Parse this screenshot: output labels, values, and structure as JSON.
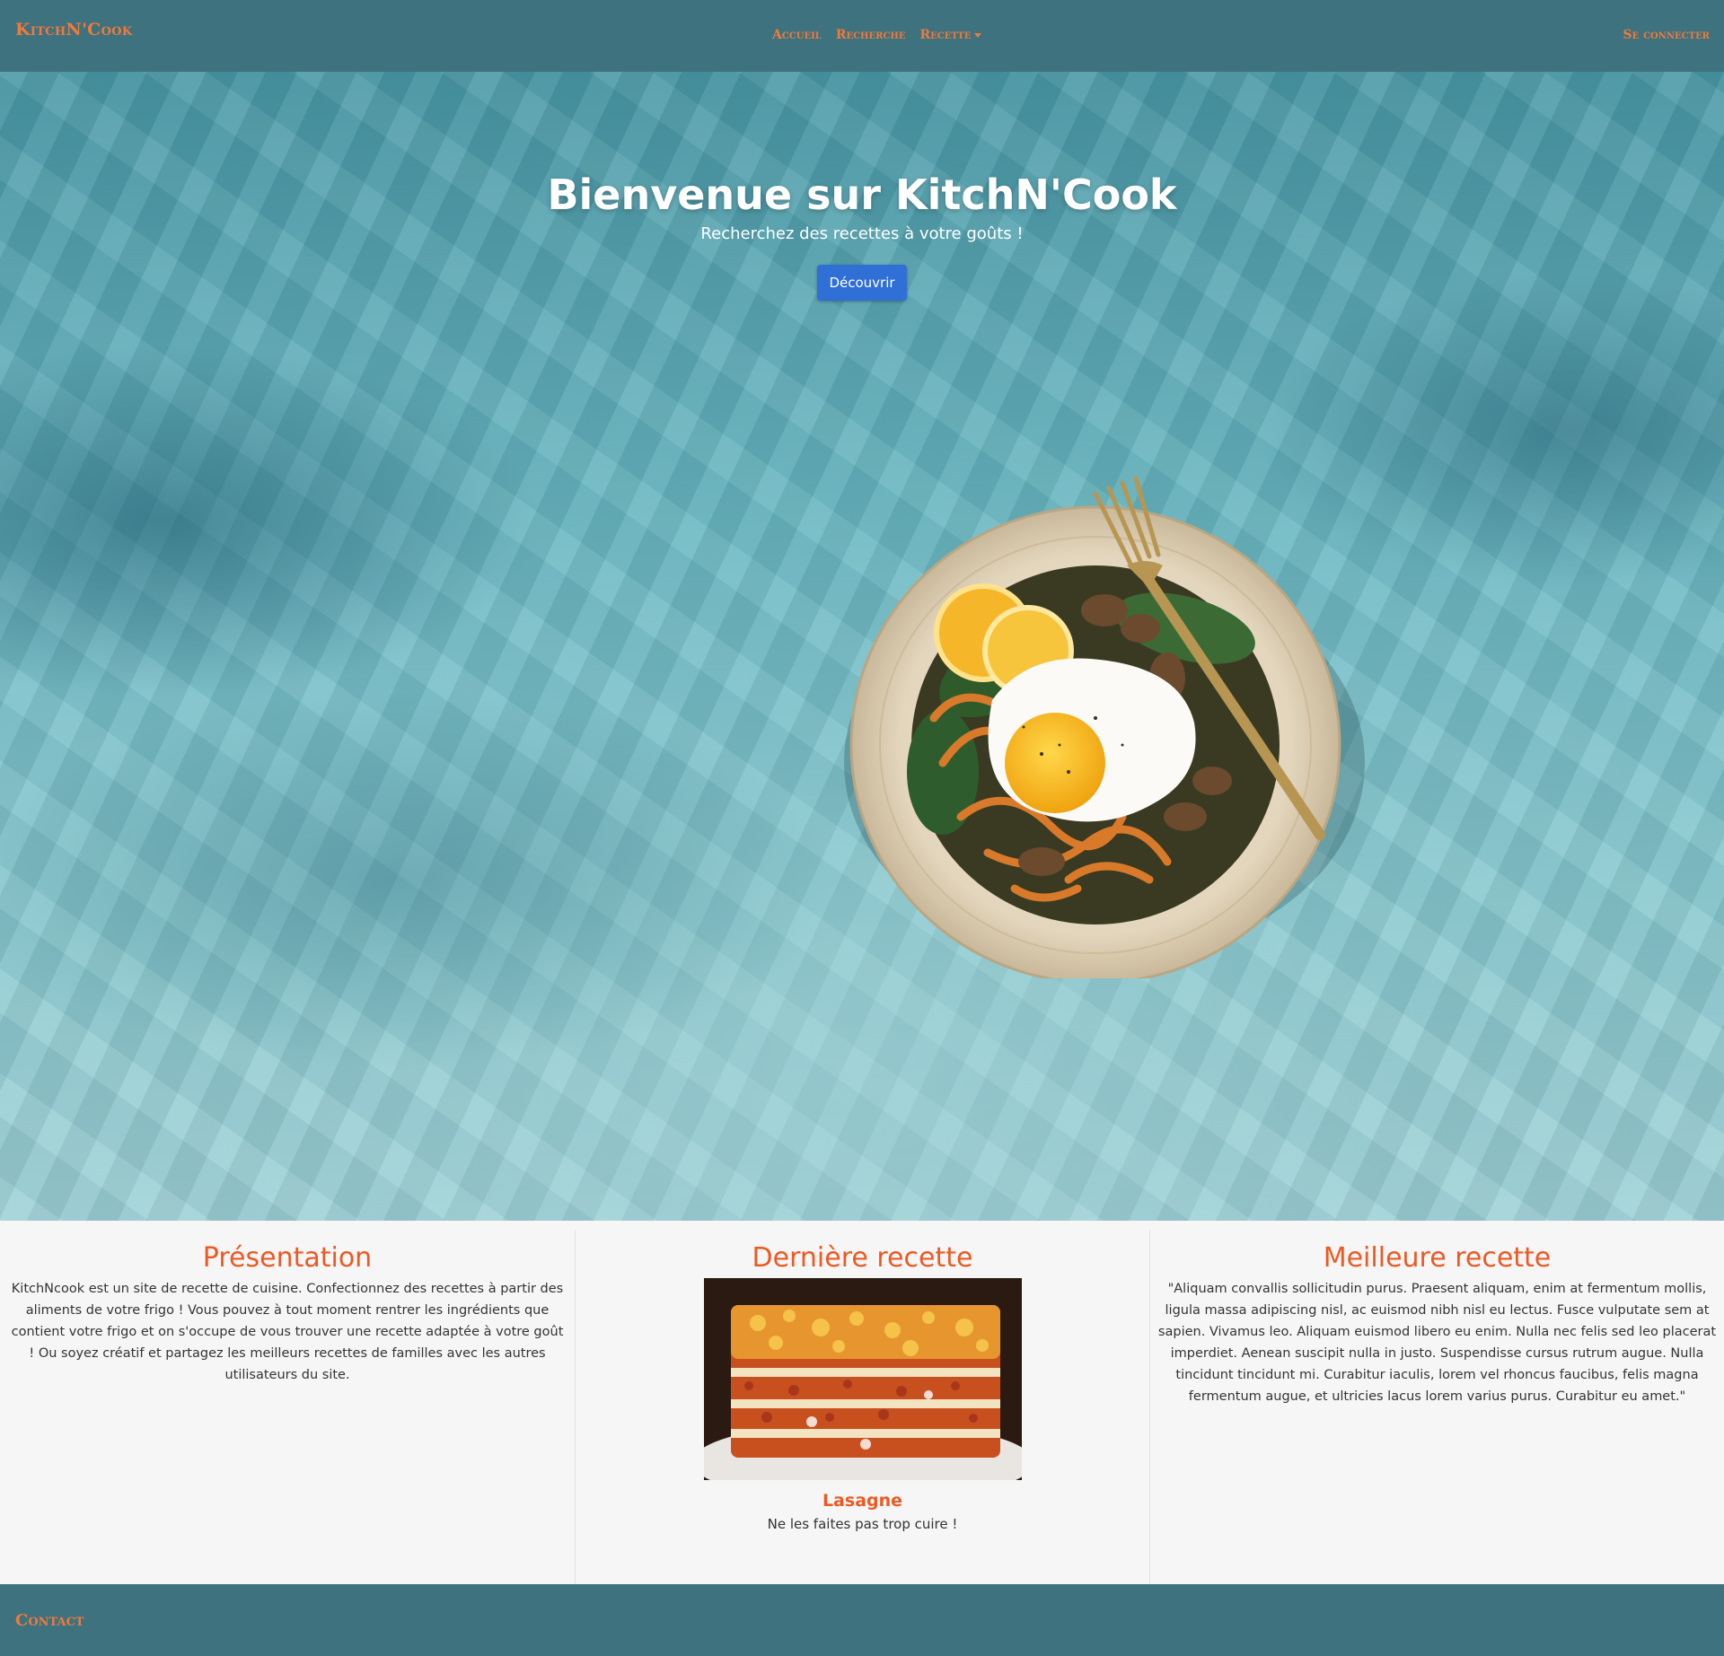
{
  "navbar": {
    "brand": "KitchN'Cook",
    "links": [
      {
        "label": "Accueil"
      },
      {
        "label": "Recherche"
      },
      {
        "label": "Recette"
      }
    ],
    "login_label": "Se connecter"
  },
  "hero": {
    "title": "Bienvenue sur KitchN'Cook",
    "subtitle": "Recherchez des recettes à votre goûts !",
    "button_label": "Découvrir"
  },
  "sections": {
    "presentation": {
      "title": "Présentation",
      "text": "KitchNcook est un site de recette de cuisine. Confectionnez des recettes à partir des aliments de votre frigo ! Vous pouvez à tout moment rentrer les ingrédients que contient votre frigo et on s'occupe de vous trouver une recette adaptée à votre goût ! Ou soyez créatif et partagez les meilleurs recettes de familles avec les autres utilisateurs du site."
    },
    "latest": {
      "title": "Dernière recette",
      "recipe_name": "Lasagne",
      "recipe_desc": "Ne les faites pas trop cuire !"
    },
    "best": {
      "title": "Meilleure recette",
      "text": "\"Aliquam convallis sollicitudin purus. Praesent aliquam, enim at fermentum mollis, ligula massa adipiscing nisl, ac euismod nibh nisl eu lectus. Fusce vulputate sem at sapien. Vivamus leo. Aliquam euismod libero eu enim. Nulla nec felis sed leo placerat imperdiet. Aenean suscipit nulla in justo. Suspendisse cursus rutrum augue. Nulla tincidunt tincidunt mi. Curabitur iaculis, lorem vel rhoncus faucibus, felis magna fermentum augue, et ultricies lacus lorem varius purus. Curabitur eu amet.\""
    }
  },
  "footer": {
    "contact_label": "Contact"
  },
  "colors": {
    "navbar_bg": "#3e727e",
    "accent": "#f07a3c",
    "heading": "#ec5a24",
    "button": "#2f6fd6"
  },
  "icons": [
    "dropdown-caret-icon"
  ]
}
